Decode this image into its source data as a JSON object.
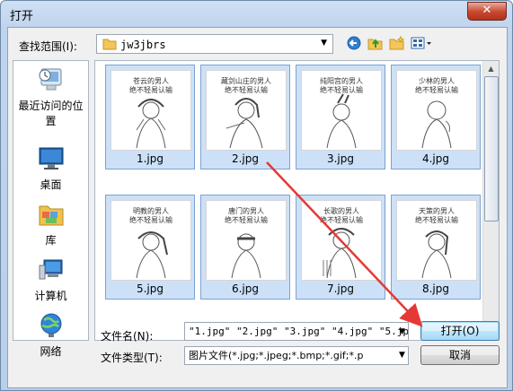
{
  "window": {
    "title": "打开",
    "close_symbol": "✕"
  },
  "toolbar": {
    "look_in_label": "查找范围(I):",
    "look_in_value": "jw3jbrs",
    "icons": [
      "back-icon",
      "up-folder-icon",
      "new-folder-icon",
      "view-menu-icon"
    ]
  },
  "places": [
    {
      "label": "最近访问的位置",
      "icon": "recent-places-icon"
    },
    {
      "label": "桌面",
      "icon": "desktop-icon"
    },
    {
      "label": "库",
      "icon": "libraries-icon"
    },
    {
      "label": "计算机",
      "icon": "computer-icon"
    },
    {
      "label": "网络",
      "icon": "network-icon"
    }
  ],
  "files": [
    {
      "name": "1.jpg",
      "caption1": "苍云的男人",
      "caption2": "绝不轻易认输"
    },
    {
      "name": "2.jpg",
      "caption1": "藏剑山庄的男人",
      "caption2": "绝不轻易认输"
    },
    {
      "name": "3.jpg",
      "caption1": "纯阳宫的男人",
      "caption2": "绝不轻易认输"
    },
    {
      "name": "4.jpg",
      "caption1": "少林的男人",
      "caption2": "绝不轻易认输"
    },
    {
      "name": "5.jpg",
      "caption1": "明教的男人",
      "caption2": "绝不轻易认输"
    },
    {
      "name": "6.jpg",
      "caption1": "唐门的男人",
      "caption2": "绝不轻易认输"
    },
    {
      "name": "7.jpg",
      "caption1": "长歌的男人",
      "caption2": "绝不轻易认输"
    },
    {
      "name": "8.jpg",
      "caption1": "天策的男人",
      "caption2": "绝不轻易认输"
    }
  ],
  "form": {
    "filename_label": "文件名(N):",
    "filename_value": "\"1.jpg\" \"2.jpg\" \"3.jpg\" \"4.jpg\" \"5.jp",
    "filetype_label": "文件类型(T):",
    "filetype_value": "图片文件(*.jpg;*.jpeg;*.bmp;*.gif;*.p",
    "open_button": "打开(O)",
    "cancel_button": "取消"
  },
  "colors": {
    "selection": "#cce1f8",
    "annotation_arrow": "#e53935"
  }
}
